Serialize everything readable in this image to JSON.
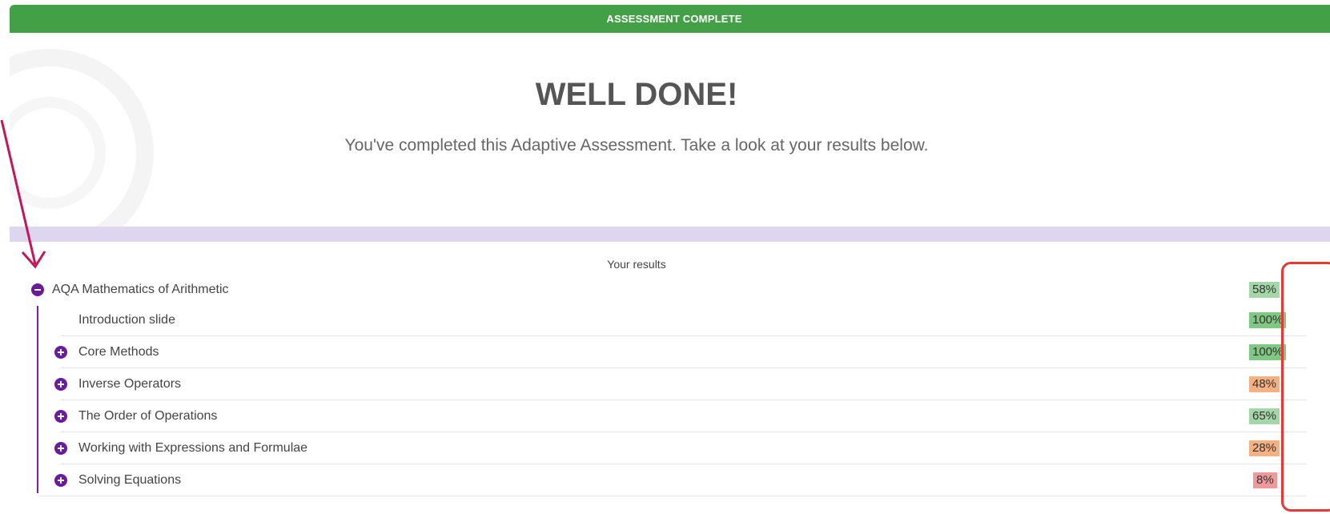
{
  "banner": {
    "text": "ASSESSMENT COMPLETE"
  },
  "hero": {
    "title": "WELL DONE!",
    "subtitle": "You've completed this Adaptive Assessment. Take a look at your results below."
  },
  "results": {
    "title": "Your results",
    "course": {
      "label": "AQA Mathematics of Arithmetic",
      "score": "58%",
      "score_color": "#a5d6a7",
      "expanded": true
    },
    "items": [
      {
        "label": "Introduction slide",
        "score": "100%",
        "score_color": "#81c784",
        "icon": "none"
      },
      {
        "label": "Core Methods",
        "score": "100%",
        "score_color": "#81c784",
        "icon": "expand-plus-icon"
      },
      {
        "label": "Inverse Operators",
        "score": "48%",
        "score_color": "#f4b183",
        "icon": "expand-plus-icon"
      },
      {
        "label": "The Order of Operations",
        "score": "65%",
        "score_color": "#a5d6a7",
        "icon": "expand-plus-icon"
      },
      {
        "label": "Working with Expressions and Formulae",
        "score": "28%",
        "score_color": "#f4b183",
        "icon": "expand-plus-icon"
      },
      {
        "label": "Solving Equations",
        "score": "8%",
        "score_color": "#ef9a9a",
        "icon": "expand-plus-icon"
      }
    ]
  },
  "colors": {
    "banner": "#43a047",
    "accent": "#6a1b9a",
    "annotation_arrow": "#c2185b",
    "annotation_box": "#e53935"
  }
}
